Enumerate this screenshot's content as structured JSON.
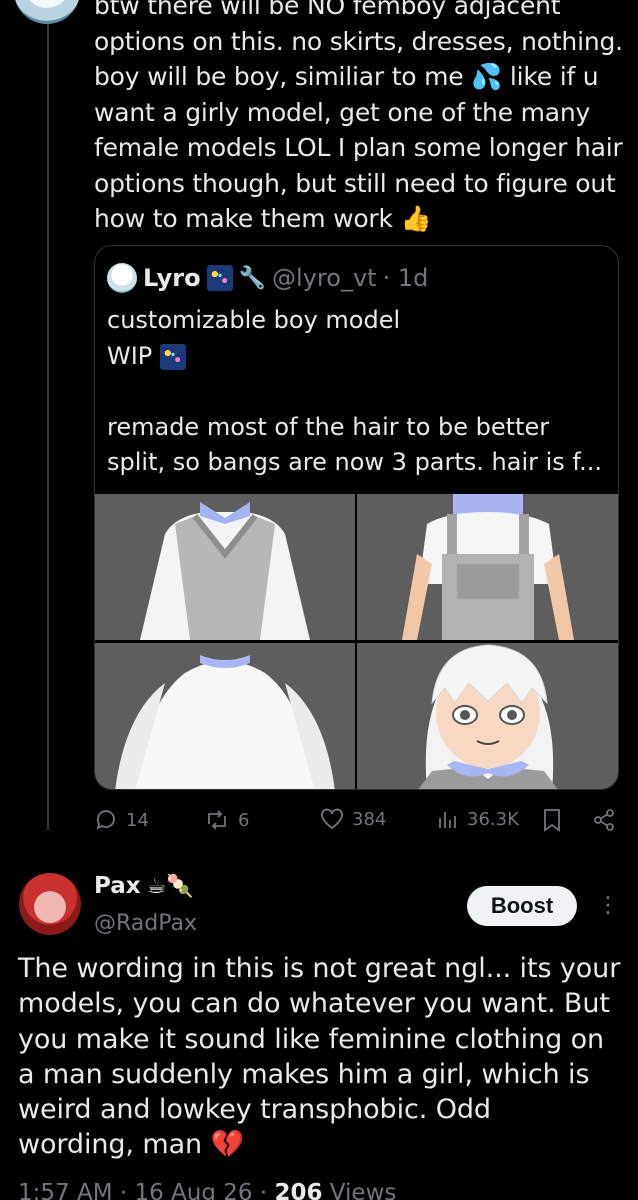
{
  "main_post": {
    "lines": [
      "btw there will be NO femboy adjacent",
      "options on this. no skirts, dresses, nothing.",
      "boy will be boy, similiar to me 💦 like if u",
      "want a girly model, get one of the many",
      "female models LOL I plan some longer hair",
      "options though, but still need to figure out",
      "how to make them work 👍"
    ]
  },
  "quoted_post": {
    "name": "Lyro",
    "handle": "@lyro_vt",
    "time": "· 1d",
    "lines": [
      "customizable boy model",
      "WIP",
      "",
      "remade most of the hair to be better",
      "split, so bangs are now 3 parts. hair is f..."
    ]
  },
  "actions": {
    "replies": "14",
    "reposts": "6",
    "likes": "384",
    "views": "36.3K"
  },
  "reply": {
    "name": "Pax",
    "name_emoji": "☕🍡",
    "handle": "@RadPax",
    "boost_label": "Boost",
    "lines": [
      "The wording in this is not great ngl... its your",
      "models, you can do whatever you want. But",
      "you make it sound like feminine clothing on",
      "a man suddenly makes him a girl, which is",
      "weird and lowkey transphobic. Odd",
      "wording, man 💔"
    ],
    "time": "1:57 AM · 16 Aug 26 · ",
    "views_count": "206",
    "views_label": " Views"
  }
}
